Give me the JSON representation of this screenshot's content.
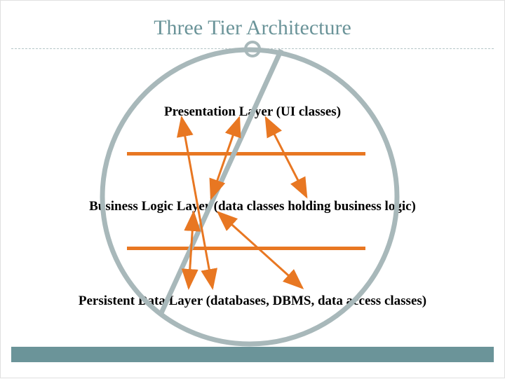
{
  "title": "Three Tier Architecture",
  "layers": {
    "presentation": "Presentation Layer (UI classes)",
    "business": "Business Logic Layer (data classes holding business logic)",
    "persistent": "Persistent Data Layer (databases, DBMS, data access classes)"
  },
  "colors": {
    "title": "#6b9499",
    "accent": "#e87722",
    "circle": "#a8b8ba"
  }
}
